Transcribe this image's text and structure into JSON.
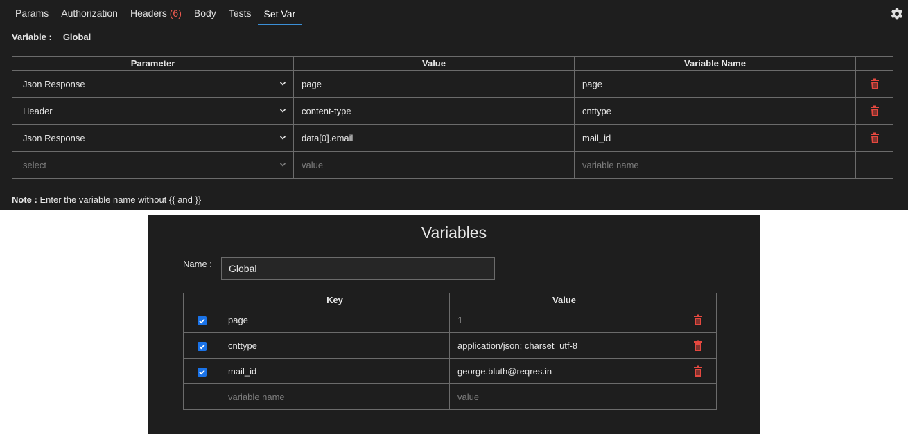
{
  "tabs": [
    {
      "label": "Params",
      "count": ""
    },
    {
      "label": "Authorization",
      "count": ""
    },
    {
      "label": "Headers",
      "count": "(6)"
    },
    {
      "label": "Body",
      "count": ""
    },
    {
      "label": "Tests",
      "count": ""
    },
    {
      "label": "Set Var",
      "count": ""
    }
  ],
  "active_tab": "Set Var",
  "variable_scope": {
    "label": "Variable :",
    "value": "Global"
  },
  "setvar_table": {
    "headers": [
      "Parameter",
      "Value",
      "Variable Name",
      ""
    ],
    "rows": [
      {
        "parameter": "Json Response",
        "value": "page",
        "variable_name": "page"
      },
      {
        "parameter": "Header",
        "value": "content-type",
        "variable_name": "cnttype"
      },
      {
        "parameter": "Json Response",
        "value": "data[0].email",
        "variable_name": "mail_id"
      }
    ],
    "new_row": {
      "parameter_placeholder": "select",
      "value_placeholder": "value",
      "variable_name_placeholder": "variable name"
    }
  },
  "note": {
    "label": "Note :",
    "text": " Enter the variable name without {{ and }}"
  },
  "variables_panel": {
    "title": "Variables",
    "name_label": "Name :",
    "name_value": "Global",
    "headers": [
      "",
      "Key",
      "Value",
      ""
    ],
    "rows": [
      {
        "checked": true,
        "key": "page",
        "value": "1"
      },
      {
        "checked": true,
        "key": "cnttype",
        "value": "application/json; charset=utf-8"
      },
      {
        "checked": true,
        "key": "mail_id",
        "value": "george.bluth@reqres.in"
      }
    ],
    "new_row": {
      "key_placeholder": "variable name",
      "value_placeholder": "value"
    }
  },
  "colors": {
    "background": "#1e1e1e",
    "accent": "#3b8fd6",
    "delete": "#e5483f",
    "checkbox": "#1a73e8",
    "border": "#6b6b6b"
  },
  "icons": {
    "settings": "gear-icon",
    "delete": "trash-icon",
    "dropdown": "chevron-down-icon",
    "checkbox": "checkbox-checked-icon"
  }
}
